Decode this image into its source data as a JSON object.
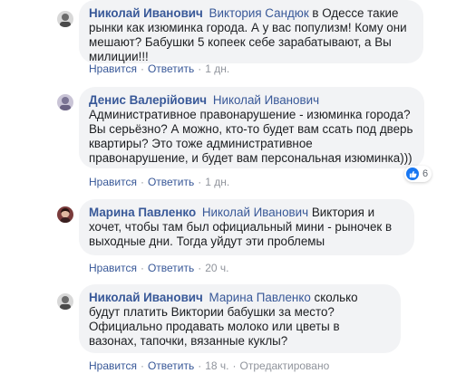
{
  "comments": [
    {
      "author": "Николай Иванович",
      "mention": "Виктория Сандюк",
      "text": " в Одессе такие рынки как изюминка города. А у вас популизм! Кому они мешают? Бабушки 5 копеек себе зарабатывают, а Вы милиции!!!",
      "like_label": "Нравится",
      "reply_label": "Ответить",
      "time": "1 дн."
    },
    {
      "author": "Денис Валерійович",
      "mention": "Николай Иванович",
      "text": " Административное правонарушение - изюминка города? Вы серьёзно? А можно, кто-то будет вам ссать под дверь квартиры? Это тоже административное правонарушение, и будет вам персональная изюминка)))",
      "like_label": "Нравится",
      "reply_label": "Ответить",
      "time": "1 дн.",
      "reaction_count": "6"
    },
    {
      "author": "Марина Павленко",
      "mention": "Николай Иванович",
      "text": " Виктория и хочет, чтобы там был официальный мини - рыночек в выходные дни. Тогда уйдут эти проблемы",
      "like_label": "Нравится",
      "reply_label": "Ответить",
      "time": "20 ч."
    },
    {
      "author": "Николай Иванович",
      "mention": "Марина Павленко",
      "text": " сколько будут платить Виктории бабушки за место? Официально продавать молоко или цветы в вазонах, тапочки, вязанные куклы?",
      "like_label": "Нравится",
      "reply_label": "Ответить",
      "time": "18 ч.",
      "edited_label": "Отредактировано"
    }
  ],
  "colors": {
    "link": "#385898",
    "bubble": "#f2f3f5",
    "text": "#1c1e21",
    "meta": "#90949c",
    "like_blue": "#1877f2"
  }
}
